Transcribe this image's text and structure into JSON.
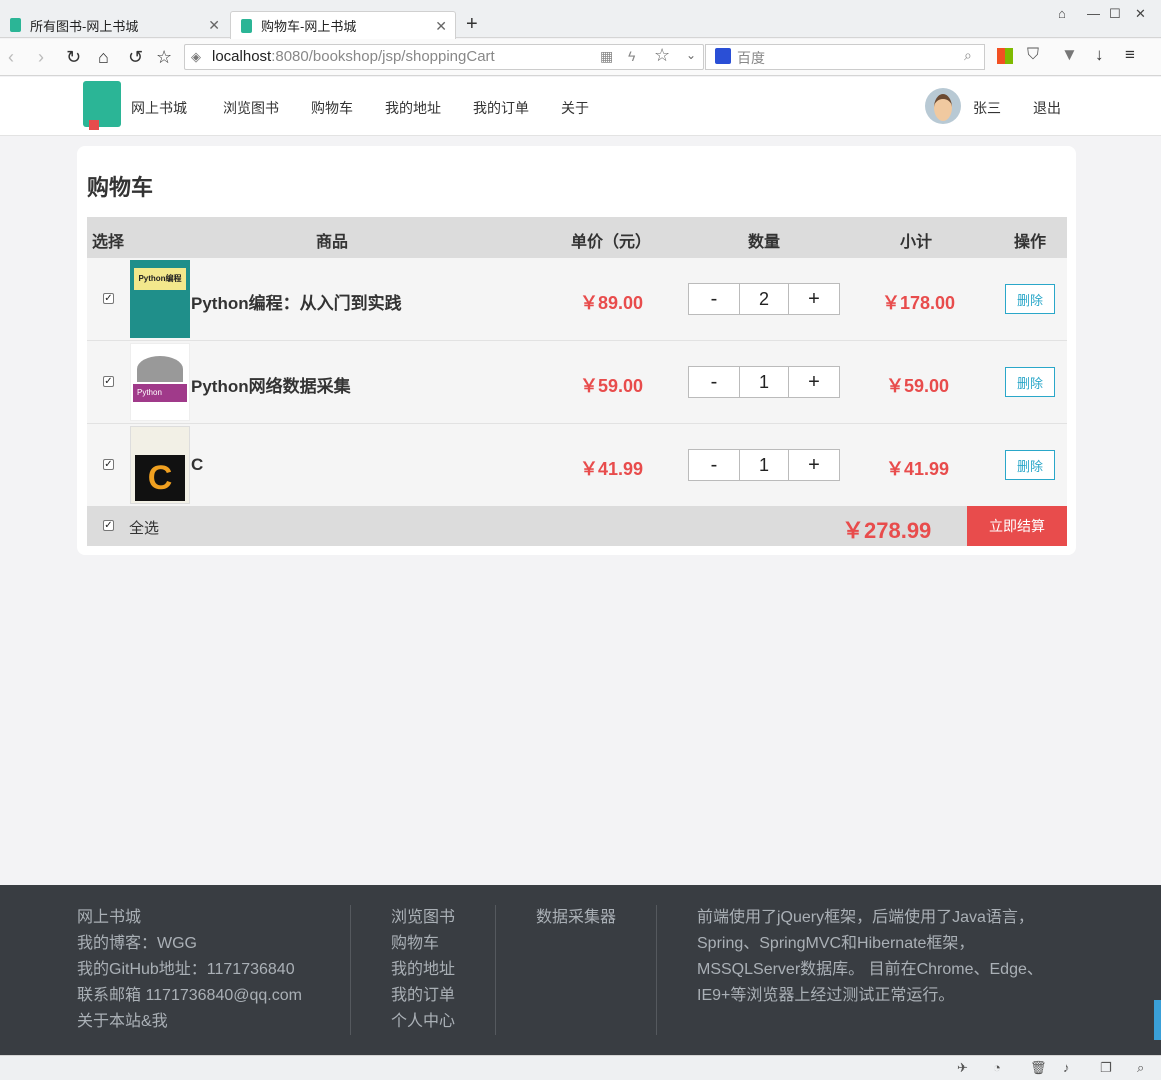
{
  "browser": {
    "tabs": [
      {
        "label": "所有图书-网上书城"
      },
      {
        "label": "购物车-网上书城"
      }
    ],
    "url_host": "localhost",
    "url_rest": ":8080/bookshop/jsp/shoppingCart",
    "search_placeholder": "百度"
  },
  "header": {
    "brand": "网上书城",
    "nav": [
      "浏览图书",
      "购物车",
      "我的地址",
      "我的订单",
      "关于"
    ],
    "user": "张三",
    "logout": "退出"
  },
  "cart": {
    "title": "购物车",
    "columns": [
      "选择",
      "商品",
      "单价（元）",
      "数量",
      "小计",
      "操作"
    ],
    "items": [
      {
        "name": "Python编程：从入门到实践",
        "price": "￥89.00",
        "qty": "2",
        "subtotal": "￥178.00",
        "checked": true,
        "cover_text": "Python编程"
      },
      {
        "name": "Python网络数据采集",
        "price": "￥59.00",
        "qty": "1",
        "subtotal": "￥59.00",
        "checked": true,
        "cover_text": "Python"
      },
      {
        "name": "C",
        "price": "￥41.99",
        "qty": "1",
        "subtotal": "￥41.99",
        "checked": true,
        "cover_text": "C"
      }
    ],
    "minus": "-",
    "plus": "+",
    "delete_label": "删除",
    "select_all": "全选",
    "total": "￥278.99",
    "checkout_label": "立即结算"
  },
  "footer": {
    "col1": [
      "网上书城",
      "我的博客：WGG",
      "我的GitHub地址：1171736840",
      "联系邮箱 1171736840@qq.com",
      "关于本站&我"
    ],
    "col2": [
      "浏览图书",
      "购物车",
      "我的地址",
      "我的订单",
      "个人中心"
    ],
    "col3": [
      "数据采集器"
    ],
    "col4": [
      "前端使用了jQuery框架，后端使用了Java语言，",
      "Spring、SpringMVC和Hibernate框架，",
      "MSSQLServer数据库。 目前在Chrome、Edge、",
      "IE9+等浏览器上经过测试正常运行。"
    ]
  }
}
